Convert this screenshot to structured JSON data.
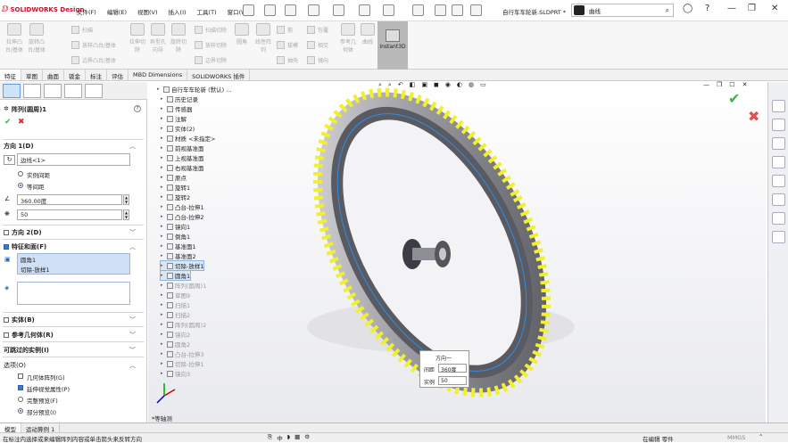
{
  "app": {
    "brand": "SOLIDWORKS Design",
    "doc_title": "自行车车轮新.SLDPRT *"
  },
  "menu": [
    "文件(F)",
    "编辑(E)",
    "视图(V)",
    "插入(I)",
    "工具(T)",
    "窗口(W)"
  ],
  "search": {
    "value": "曲线"
  },
  "ribbon": {
    "buttons": [
      {
        "label": "拉伸凸台/基体"
      },
      {
        "label": "旋转凸台/基体"
      },
      {
        "label": "拉伸切除"
      },
      {
        "label": "异型孔向导"
      },
      {
        "label": "旋转切除"
      },
      {
        "label": "圆角"
      },
      {
        "label": "线性阵列"
      },
      {
        "label": "参考几何体"
      },
      {
        "label": "曲线"
      }
    ],
    "small": [
      "扫描",
      "放样凸台/基体",
      "边界凸台/基体",
      "扫描切除",
      "放样切除",
      "边界切除",
      "筋",
      "拔模",
      "抽壳",
      "包覆",
      "相交",
      "镜向"
    ],
    "instant3d": "Instant3D"
  },
  "tabs": [
    "特征",
    "草图",
    "曲面",
    "钣金",
    "标注",
    "评估",
    "MBD Dimensions",
    "SOLIDWORKS 插件"
  ],
  "panel": {
    "title": "阵列(圆周)1",
    "help": "?",
    "dir1": {
      "label": "方向 1(D)",
      "edge": "边线<1>",
      "radio1": "实例间距",
      "radio2": "等间距",
      "angle": "360.00度",
      "count": "50"
    },
    "dir2": {
      "label": "方向 2(D)"
    },
    "features": {
      "label": "特征和面(F)",
      "items": [
        "圆角1",
        "切除-放样1"
      ]
    },
    "bodies": "实体(B)",
    "refgeo": "参考几何体(R)",
    "skip": "可跳过的实例(I)",
    "options": {
      "label": "选项(O)",
      "opt1": "几何体阵列(G)",
      "opt2": "延伸视觉属性(P)",
      "opt3": "完整预览(F)",
      "opt4": "部分预览(I)"
    }
  },
  "tree": {
    "root": "自行车车轮新 (默认) ...",
    "items": [
      {
        "label": "历史记录",
        "state": "normal"
      },
      {
        "label": "传感器",
        "state": "normal"
      },
      {
        "label": "注解",
        "state": "normal"
      },
      {
        "label": "实体(2)",
        "state": "normal"
      },
      {
        "label": "材质 <未指定>",
        "state": "normal"
      },
      {
        "label": "前视基准面",
        "state": "normal"
      },
      {
        "label": "上视基准面",
        "state": "normal"
      },
      {
        "label": "右视基准面",
        "state": "normal"
      },
      {
        "label": "原点",
        "state": "normal"
      },
      {
        "label": "旋转1",
        "state": "normal"
      },
      {
        "label": "旋转2",
        "state": "normal"
      },
      {
        "label": "凸台-拉伸1",
        "state": "normal"
      },
      {
        "label": "凸台-拉伸2",
        "state": "normal"
      },
      {
        "label": "镜向1",
        "state": "normal"
      },
      {
        "label": "倒角1",
        "state": "normal"
      },
      {
        "label": "基准面1",
        "state": "normal"
      },
      {
        "label": "基准面2",
        "state": "normal"
      },
      {
        "label": "切除-放样1",
        "state": "hl"
      },
      {
        "label": "圆角1",
        "state": "hl"
      },
      {
        "label": "阵列(圆周)1",
        "state": "grey"
      },
      {
        "label": "草图9",
        "state": "grey"
      },
      {
        "label": "扫描1",
        "state": "grey"
      },
      {
        "label": "扫描2",
        "state": "grey"
      },
      {
        "label": "阵列(圆周)2",
        "state": "grey"
      },
      {
        "label": "镜向2",
        "state": "grey"
      },
      {
        "label": "圆角2",
        "state": "grey"
      },
      {
        "label": "凸台-拉伸3",
        "state": "grey"
      },
      {
        "label": "切除-拉伸1",
        "state": "grey"
      },
      {
        "label": "镜向3",
        "state": "grey"
      }
    ]
  },
  "popup": {
    "title": "方向一",
    "row1_label": "间距",
    "row1_value": "360度",
    "row2_label": "实例",
    "row2_value": "50"
  },
  "view_label": "*等轴测",
  "bottom_tabs": [
    "模型",
    "运动算例 1"
  ],
  "status": {
    "left": "在标注内选择或来编辑阵列内容或单击箭头来反转方向",
    "mid": "在编辑 零件",
    "units": "MMGS"
  },
  "colors": {
    "tread": "#f2ef2c",
    "tire": "#6a6a70",
    "accent": "#2066c8"
  }
}
